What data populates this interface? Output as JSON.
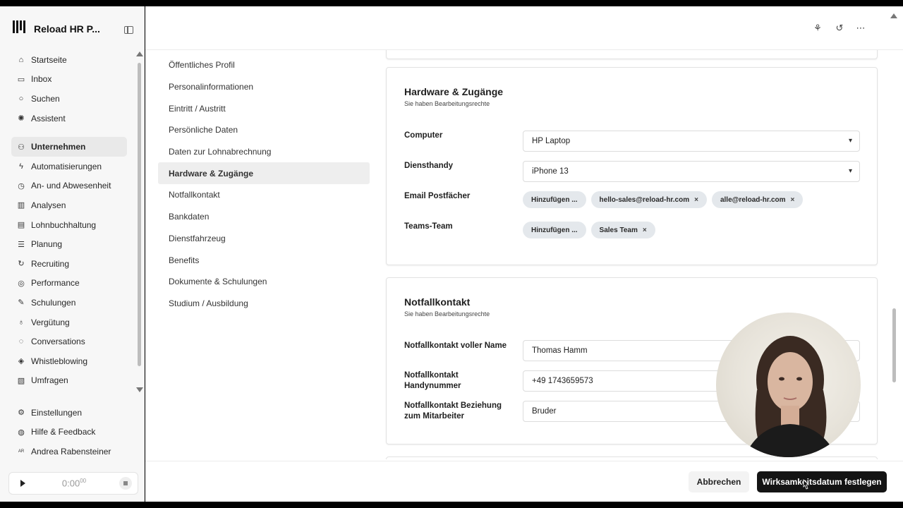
{
  "app": {
    "title": "Reload HR P..."
  },
  "sidebar": {
    "items": [
      {
        "label": "Startseite",
        "icon": "home-icon",
        "glyph": "⌂"
      },
      {
        "label": "Inbox",
        "icon": "inbox-icon",
        "glyph": "▭"
      },
      {
        "label": "Suchen",
        "icon": "search-icon",
        "glyph": "○"
      },
      {
        "label": "Assistent",
        "icon": "assistant-icon",
        "glyph": "✺"
      },
      {
        "label": "Unternehmen",
        "icon": "company-icon",
        "glyph": "⚇"
      },
      {
        "label": "Automatisierungen",
        "icon": "automation-icon",
        "glyph": "ϟ"
      },
      {
        "label": "An- und Abwesenheit",
        "icon": "absence-icon",
        "glyph": "◷"
      },
      {
        "label": "Analysen",
        "icon": "analytics-icon",
        "glyph": "▥"
      },
      {
        "label": "Lohnbuchhaltung",
        "icon": "payroll-icon",
        "glyph": "▤"
      },
      {
        "label": "Planung",
        "icon": "planning-icon",
        "glyph": "☰"
      },
      {
        "label": "Recruiting",
        "icon": "recruiting-icon",
        "glyph": "↻"
      },
      {
        "label": "Performance",
        "icon": "performance-icon",
        "glyph": "◎"
      },
      {
        "label": "Schulungen",
        "icon": "training-icon",
        "glyph": "✎"
      },
      {
        "label": "Vergütung",
        "icon": "compensation-icon",
        "glyph": "♁"
      },
      {
        "label": "Conversations",
        "icon": "conversations-icon",
        "glyph": "◌"
      },
      {
        "label": "Whistleblowing",
        "icon": "shield-icon",
        "glyph": "◈"
      },
      {
        "label": "Umfragen",
        "icon": "survey-icon",
        "glyph": "▧"
      }
    ],
    "bottom_items": [
      {
        "label": "Einstellungen",
        "icon": "gear-icon",
        "glyph": "⚙"
      },
      {
        "label": "Hilfe & Feedback",
        "icon": "help-icon",
        "glyph": "◍"
      },
      {
        "label": "Andrea Rabensteiner",
        "icon": "avatar-icon",
        "glyph": "AR"
      }
    ],
    "player_time": "0:00",
    "player_time_sub": "00"
  },
  "subnav": {
    "items": [
      "Öffentliches Profil",
      "Personalinformationen",
      "Eintritt / Austritt",
      "Persönliche Daten",
      "Daten zur Lohnabrechnung",
      "Hardware & Zugänge",
      "Notfallkontakt",
      "Bankdaten",
      "Dienstfahrzeug",
      "Benefits",
      "Dokumente & Schulungen",
      "Studium / Ausbildung"
    ],
    "active": "Hardware & Zugänge"
  },
  "hardware": {
    "title": "Hardware & Zugänge",
    "subtitle": "Sie haben Bearbeitungsrechte",
    "computer_label": "Computer",
    "computer_value": "HP Laptop",
    "phone_label": "Diensthandy",
    "phone_value": "iPhone 13",
    "email_label": "Email Postfächer",
    "email_add": "Hinzufügen ...",
    "email_chips": [
      "hello-sales@reload-hr.com",
      "alle@reload-hr.com"
    ],
    "teams_label": "Teams-Team",
    "teams_add": "Hinzufügen ...",
    "teams_chips": [
      "Sales Team"
    ]
  },
  "emergency": {
    "title": "Notfallkontakt",
    "subtitle": "Sie haben Bearbeitungsrechte",
    "name_label": "Notfallkontakt voller Name",
    "name_value": "Thomas Hamm",
    "phone_label": "Notfallkontakt Handynummer",
    "phone_value": "+49 1743659573",
    "relation_label": "Notfallkontakt Beziehung zum Mitarbeiter",
    "relation_value": "Bruder"
  },
  "footer": {
    "cancel_label": "Abbrechen",
    "confirm_label": "Wirksamkeitsdatum festlegen"
  }
}
